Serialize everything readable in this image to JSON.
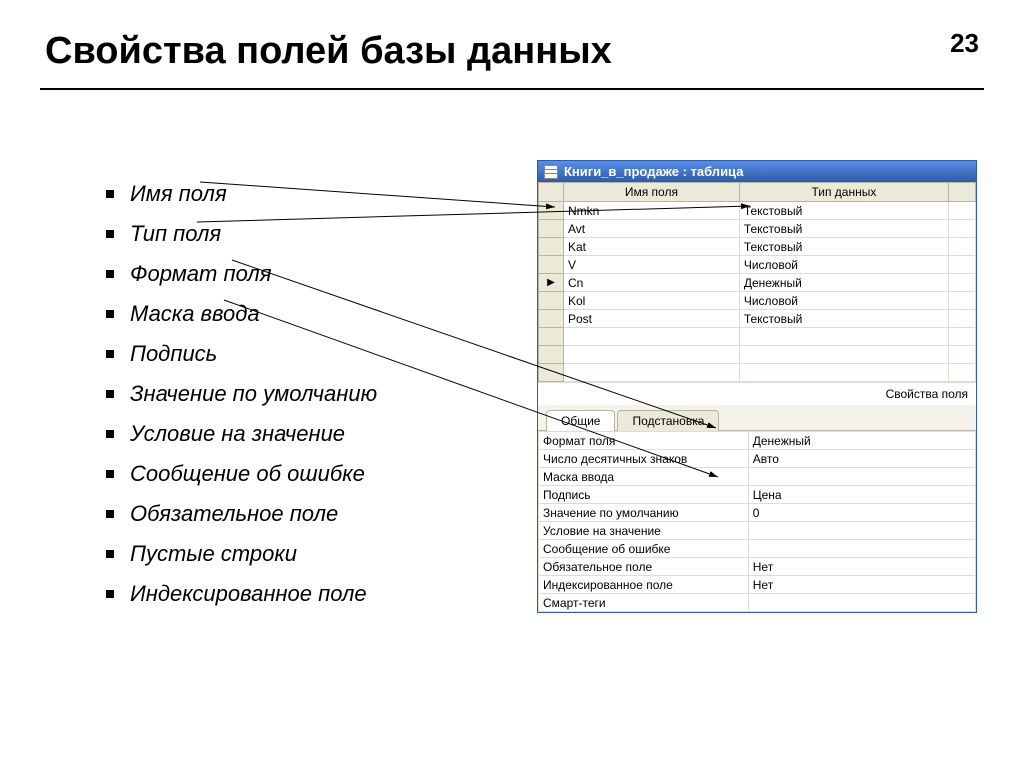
{
  "page_number": "23",
  "title": "Свойства полей базы данных",
  "bullets": [
    "Имя поля",
    "Тип поля",
    "Формат поля",
    "Маска ввода",
    "Подпись",
    "Значение по умолчанию",
    "Условие на значение",
    "Сообщение об ошибке",
    "Обязательное поле",
    "Пустые строки",
    "Индексированное поле"
  ],
  "access_window": {
    "title": "Книги_в_продаже : таблица",
    "columns": [
      "Имя поля",
      "Тип данных"
    ],
    "rows": [
      {
        "sel": "",
        "name": "Nmkn",
        "type": "Текстовый"
      },
      {
        "sel": "",
        "name": "Avt",
        "type": "Текстовый"
      },
      {
        "sel": "",
        "name": "Kat",
        "type": "Текстовый"
      },
      {
        "sel": "",
        "name": "V",
        "type": "Числовой"
      },
      {
        "sel": "▶",
        "name": "Cn",
        "type": "Денежный"
      },
      {
        "sel": "",
        "name": "Kol",
        "type": "Числовой"
      },
      {
        "sel": "",
        "name": "Post",
        "type": "Текстовый"
      }
    ],
    "properties_header": "Свойства поля",
    "tabs": {
      "active": "Общие",
      "other": "Подстановка"
    },
    "properties": [
      {
        "label": "Формат поля",
        "value": "Денежный"
      },
      {
        "label": "Число десятичных знаков",
        "value": "Авто"
      },
      {
        "label": "Маска ввода",
        "value": ""
      },
      {
        "label": "Подпись",
        "value": "Цена"
      },
      {
        "label": "Значение по умолчанию",
        "value": "0"
      },
      {
        "label": "Условие на значение",
        "value": ""
      },
      {
        "label": "Сообщение об ошибке",
        "value": ""
      },
      {
        "label": "Обязательное поле",
        "value": "Нет"
      },
      {
        "label": "Индексированное поле",
        "value": "Нет"
      },
      {
        "label": "Смарт-теги",
        "value": ""
      }
    ]
  }
}
